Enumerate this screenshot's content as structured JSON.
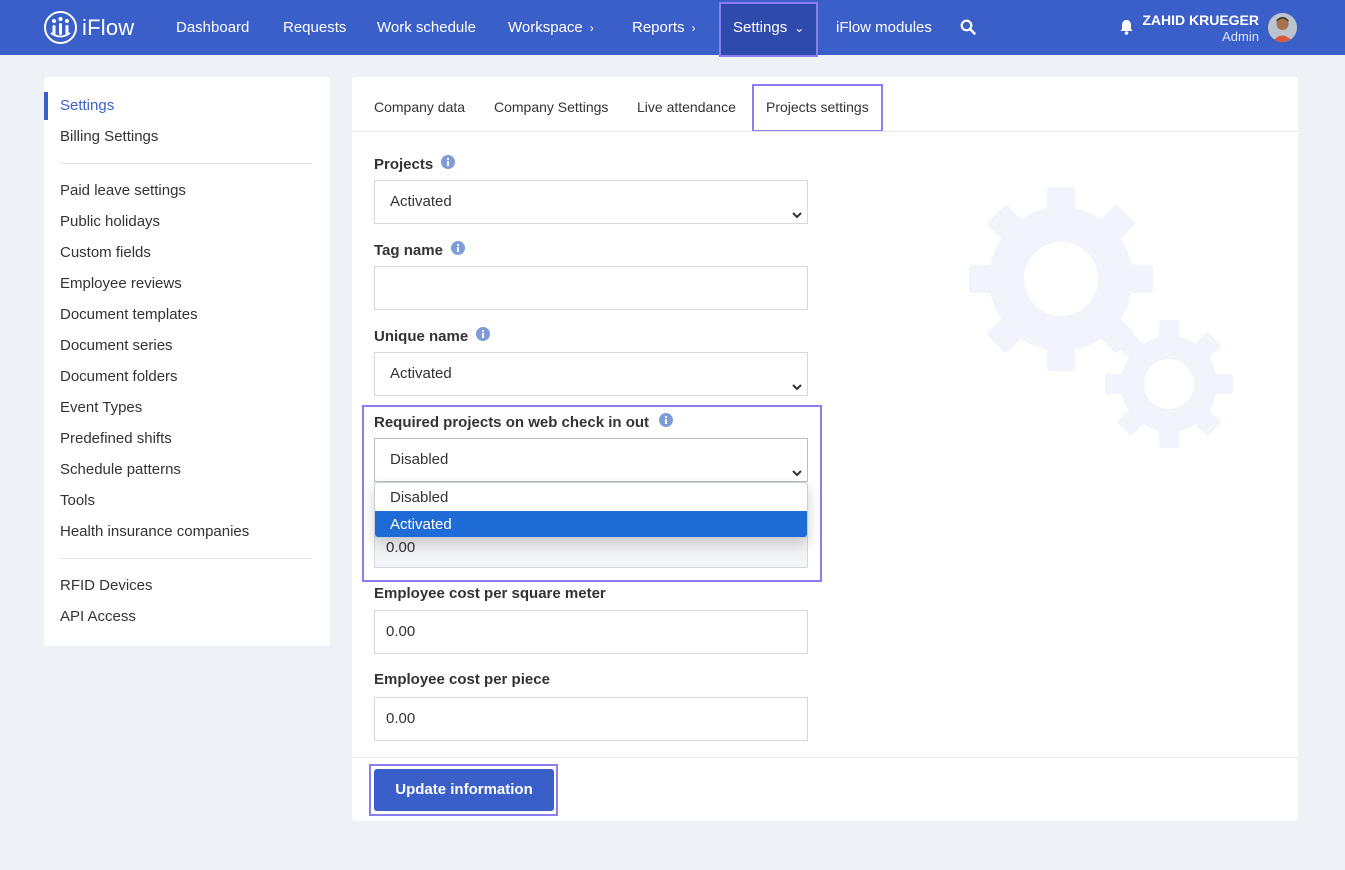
{
  "app": {
    "brand": "iFlow",
    "accent_color": "#3b5fc8",
    "highlight_color": "#8a7ef0"
  },
  "nav": {
    "items": [
      {
        "label": "Dashboard"
      },
      {
        "label": "Requests"
      },
      {
        "label": "Work schedule"
      },
      {
        "label": "Workspace",
        "icon": "chevron-right-icon"
      },
      {
        "label": "Reports",
        "icon": "chevron-right-icon"
      },
      {
        "label": "Settings",
        "icon": "chevron-down-icon",
        "active": true
      },
      {
        "label": "iFlow modules"
      }
    ],
    "search_icon": "search-icon",
    "notifications_icon": "bell-icon"
  },
  "user": {
    "name": "ZAHID KRUEGER",
    "role": "Admin"
  },
  "sidebar": {
    "groups": [
      [
        {
          "label": "Settings",
          "active": true
        },
        {
          "label": "Billing Settings"
        }
      ],
      [
        {
          "label": "Paid leave settings"
        },
        {
          "label": "Public holidays"
        },
        {
          "label": "Custom fields"
        },
        {
          "label": "Employee reviews"
        },
        {
          "label": "Document templates"
        },
        {
          "label": "Document series"
        },
        {
          "label": "Document folders"
        },
        {
          "label": "Event Types"
        },
        {
          "label": "Predefined shifts"
        },
        {
          "label": "Schedule patterns"
        },
        {
          "label": "Tools"
        },
        {
          "label": "Health insurance companies"
        }
      ],
      [
        {
          "label": "RFID Devices"
        },
        {
          "label": "API Access"
        }
      ]
    ]
  },
  "tabs": [
    {
      "label": "Company data"
    },
    {
      "label": "Company Settings"
    },
    {
      "label": "Live attendance"
    },
    {
      "label": "Projects settings",
      "active": true
    }
  ],
  "form": {
    "projects": {
      "label": "Projects",
      "value": "Activated"
    },
    "tag_name": {
      "label": "Tag name",
      "value": ""
    },
    "unique_name": {
      "label": "Unique name",
      "value": "Activated"
    },
    "required_projects": {
      "label": "Required projects on web check in out",
      "value": "Disabled",
      "options": [
        {
          "label": "Disabled"
        },
        {
          "label": "Activated",
          "highlighted": true
        }
      ]
    },
    "hidden_cost": {
      "value": "0.00"
    },
    "cost_per_square_meter": {
      "label": "Employee cost per square meter",
      "value": "0.00"
    },
    "cost_per_piece": {
      "label": "Employee cost per piece",
      "value": "0.00"
    }
  },
  "actions": {
    "update_label": "Update information"
  }
}
